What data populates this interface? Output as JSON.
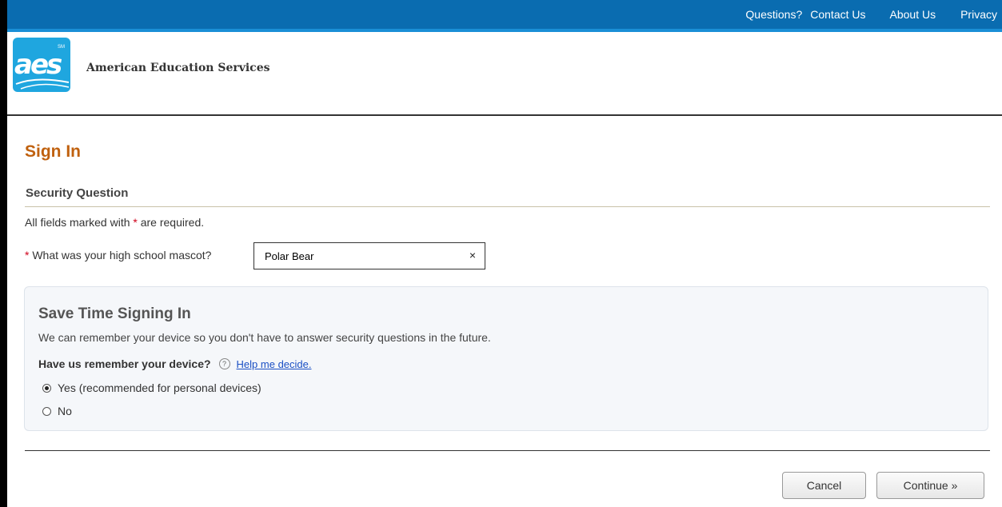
{
  "topnav": {
    "questions": "Questions?",
    "contact": "Contact Us",
    "about": "About Us",
    "privacy": "Privacy"
  },
  "header": {
    "logo_text": "aes",
    "logo_mark": "SM",
    "org_name": "American Education Services"
  },
  "page": {
    "title": "Sign In",
    "section_title": "Security Question",
    "required_note_prefix": "All fields marked with",
    "required_star": "*",
    "required_note_suffix": "are required."
  },
  "security": {
    "question": "What was your high school mascot?",
    "answer": "Polar Bear",
    "clear_glyph": "×"
  },
  "remember": {
    "title": "Save Time Signing In",
    "description": "We can remember your device so you don't have to answer security questions in the future.",
    "prompt": "Have us remember your device?",
    "help_glyph": "?",
    "help_link": "Help me decide.",
    "options": [
      {
        "label": "Yes (recommended for personal devices)",
        "selected": true
      },
      {
        "label": "No",
        "selected": false
      }
    ]
  },
  "buttons": {
    "cancel": "Cancel",
    "continue": "Continue »"
  },
  "colors": {
    "topbar": "#0a6cb0",
    "title": "#c0610f",
    "link": "#1a4fc4",
    "required": "#d0021b"
  },
  "icons": [
    "aes-logo-icon",
    "clear-icon",
    "help-icon",
    "radio-icon"
  ]
}
